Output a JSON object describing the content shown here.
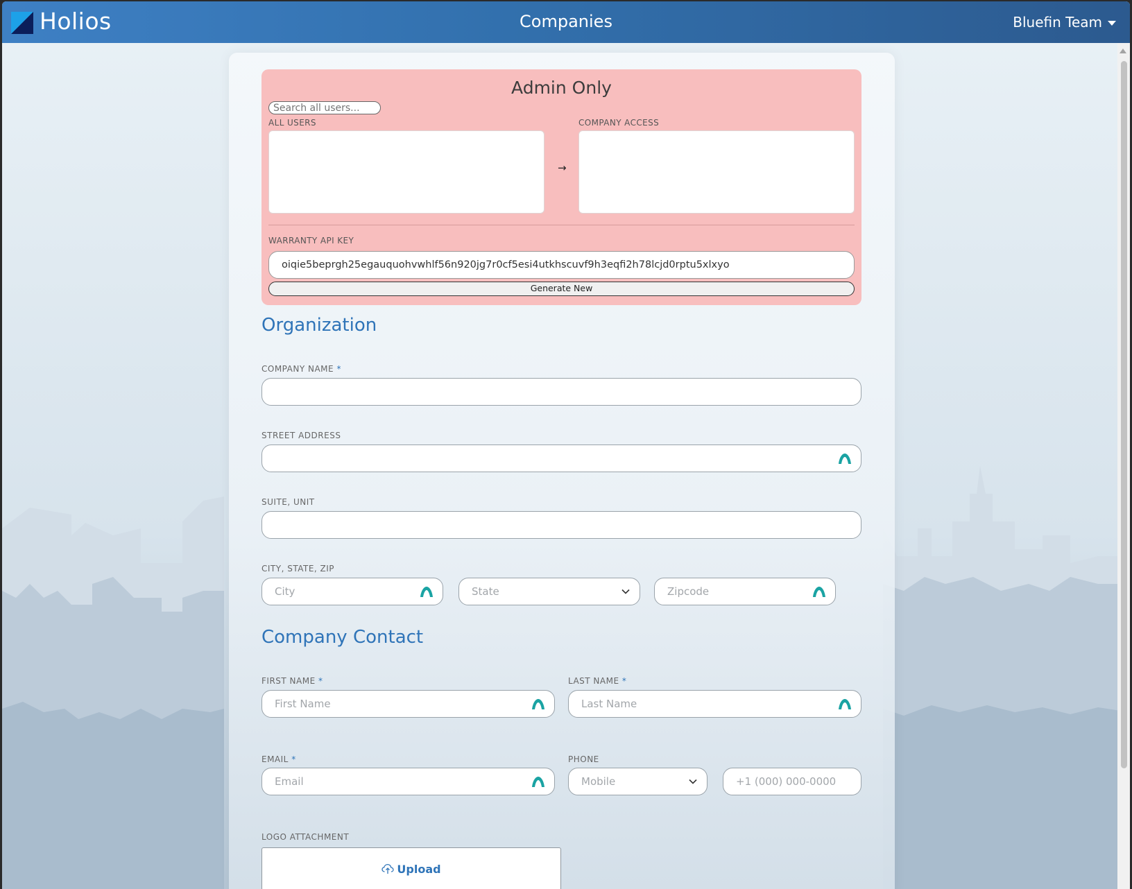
{
  "header": {
    "brand": "Holios",
    "title": "Companies",
    "team": "Bluefin Team"
  },
  "admin": {
    "title": "Admin Only",
    "search_placeholder": "Search all users...",
    "all_users_label": "ALL USERS",
    "company_access_label": "COMPANY ACCESS",
    "api_key_label": "WARRANTY API KEY",
    "api_key_value": "oiqie5beprgh25egauquohvwhlf56n920jg7r0cf5esi4utkhscuvf9h3eqfi2h78lcjd0rptu5xlxyo",
    "generate_label": "Generate New"
  },
  "organization": {
    "section_title": "Organization",
    "company_name_label": "COMPANY NAME",
    "street_label": "STREET ADDRESS",
    "suite_label": "SUITE, UNIT",
    "csz_label": "CITY, STATE, ZIP",
    "city_placeholder": "City",
    "state_placeholder": "State",
    "zip_placeholder": "Zipcode",
    "required_mark": "*"
  },
  "contact": {
    "section_title": "Company Contact",
    "first_name_label": "FIRST NAME",
    "first_name_placeholder": "First Name",
    "last_name_label": "LAST NAME",
    "last_name_placeholder": "Last Name",
    "email_label": "EMAIL",
    "email_placeholder": "Email",
    "phone_label": "PHONE",
    "phone_type": "Mobile",
    "phone_placeholder": "+1 (000) 000-0000",
    "required_mark": "*"
  },
  "logo": {
    "label": "LOGO ATTACHMENT",
    "upload_label": "Upload"
  },
  "colors": {
    "header": "#3270ad",
    "accent": "#2f74b8",
    "admin_bg": "#f8bebe",
    "autofill_icon": "#1aa3a3"
  }
}
